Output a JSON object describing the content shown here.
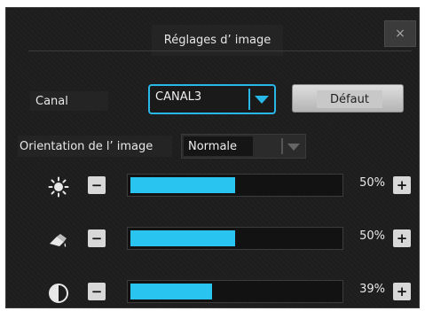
{
  "dialog": {
    "title": "Réglages d’ image",
    "close_label": "×"
  },
  "channel": {
    "label": "Canal",
    "selected": "CANAL3",
    "default_button": "Défaut"
  },
  "orientation": {
    "label": "Orientation de l’ image",
    "selected": "Normale"
  },
  "sliders": [
    {
      "name": "brightness",
      "icon": "sun-icon",
      "value_percent": 50,
      "value_text": "50%",
      "minus_label": "−",
      "plus_label": "+"
    },
    {
      "name": "saturation",
      "icon": "paint-bucket-icon",
      "value_percent": 50,
      "value_text": "50%",
      "minus_label": "−",
      "plus_label": "+"
    },
    {
      "name": "contrast",
      "icon": "contrast-icon",
      "value_percent": 39,
      "value_text": "39%",
      "minus_label": "−",
      "plus_label": "+"
    }
  ],
  "colors": {
    "accent": "#29c4ef",
    "background": "#1d1d1d"
  }
}
